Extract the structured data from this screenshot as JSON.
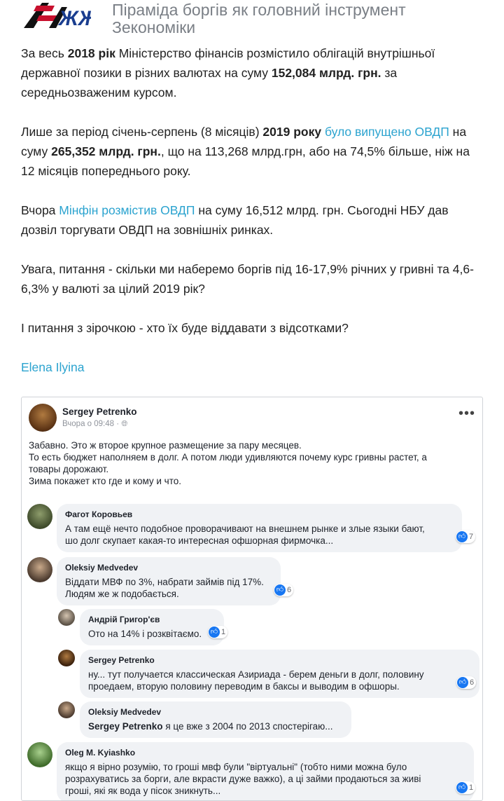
{
  "header": {
    "logo_text": "ЖЖ",
    "title": "Піраміда боргів як головний інструмент Зекономіки"
  },
  "article": {
    "p1": {
      "t1": "За весь ",
      "b1": "2018 рік",
      "t2": " Міністерство фінансів розмістило облігацій внутрішньої державної позики в різних валютах на суму ",
      "b2": "152,084 млрд. грн.",
      "t3": " за середньозваженим курсом."
    },
    "p2": {
      "t1": "Лише за період січень-серпень (8 місяців) ",
      "b1": "2019 року",
      "t2": " ",
      "link": "було випущено ОВДП",
      "t3": " на суму ",
      "b2": "265,352 млрд. грн.",
      "t4": ", що на 113,268 млрд.грн, або на 74,5% більше, ніж на 12 місяців попереднього року."
    },
    "p3": {
      "t1": "Вчора ",
      "link": "Мінфін розмістив ОВДП",
      "t2": " на суму 16,512 млрд. грн. Сьогодні НБУ дав дозвіл торгувати ОВДП на зовнішніх ринках."
    },
    "p4": "Увага, питання - скільки ми наберемо боргів під 16-17,9% річних у гривні та 4,6- 6,3% у валюті за цілий 2019 рік?",
    "p5": "І питання з зірочкою - хто їх буде віддавати з відсотками?",
    "author": "Elena Ilyina"
  },
  "post": {
    "author": "Sergey Petrenko",
    "time": "Вчора о 09:48 · ",
    "globe_icon": "globe-icon",
    "more": "•••",
    "lines": [
      "Забавно. Это ж второе крупное размещение за пару месяцев.",
      "То есть бюджет наполняем в долг. А потом люди удивляются почему курс гривны растет, а",
      "товары дорожают.",
      "Зима покажет кто где и кому и что."
    ]
  },
  "comments": [
    {
      "name": "Фагот Коровьев",
      "lines": [
        "А там ещё нечто подобное проворачивают на внешнем рынке и злые языки бают,",
        "шо долг скупает какая-то интересная офшорная фирмочка..."
      ],
      "likes": "7"
    },
    {
      "name": "Oleksiy Medvedev",
      "lines": [
        "Віддати МВФ по 3%, набрати займів під 17%.",
        "Людям же ж подобається."
      ],
      "likes": "6"
    },
    {
      "name": "Андрій Григор'єв",
      "lines": [
        "Ото на 14% і розквітаємо."
      ],
      "likes": "1"
    },
    {
      "name": "Sergey Petrenko",
      "lines": [
        "ну... тут получается классическая Азириада - берем деньги в долг, половину",
        "проедаем, вторую половину переводим в баксы и выводим в офшоры."
      ],
      "likes": "6"
    },
    {
      "name": "Oleksiy Medvedev",
      "tag": "Sergey Petrenko",
      "text": " я це вже з 2004 по 2013 спостерігаю..."
    },
    {
      "name": "Oleg M. Kyiashko",
      "lines": [
        "якщо я вірно розумію, то гроші мвф були \"віртуальні\" (тобто ними можна було",
        "розрахуватись за борги, але вкрасти дуже важко), а ці займи продаються за живі",
        "гроші, які як вода у пісок зникнуть..."
      ],
      "likes": "1"
    }
  ],
  "colors": {
    "link": "#2ba3cf",
    "title": "#7a7f86",
    "fb_like": "#1877f2",
    "bubble": "#f0f2f5"
  }
}
